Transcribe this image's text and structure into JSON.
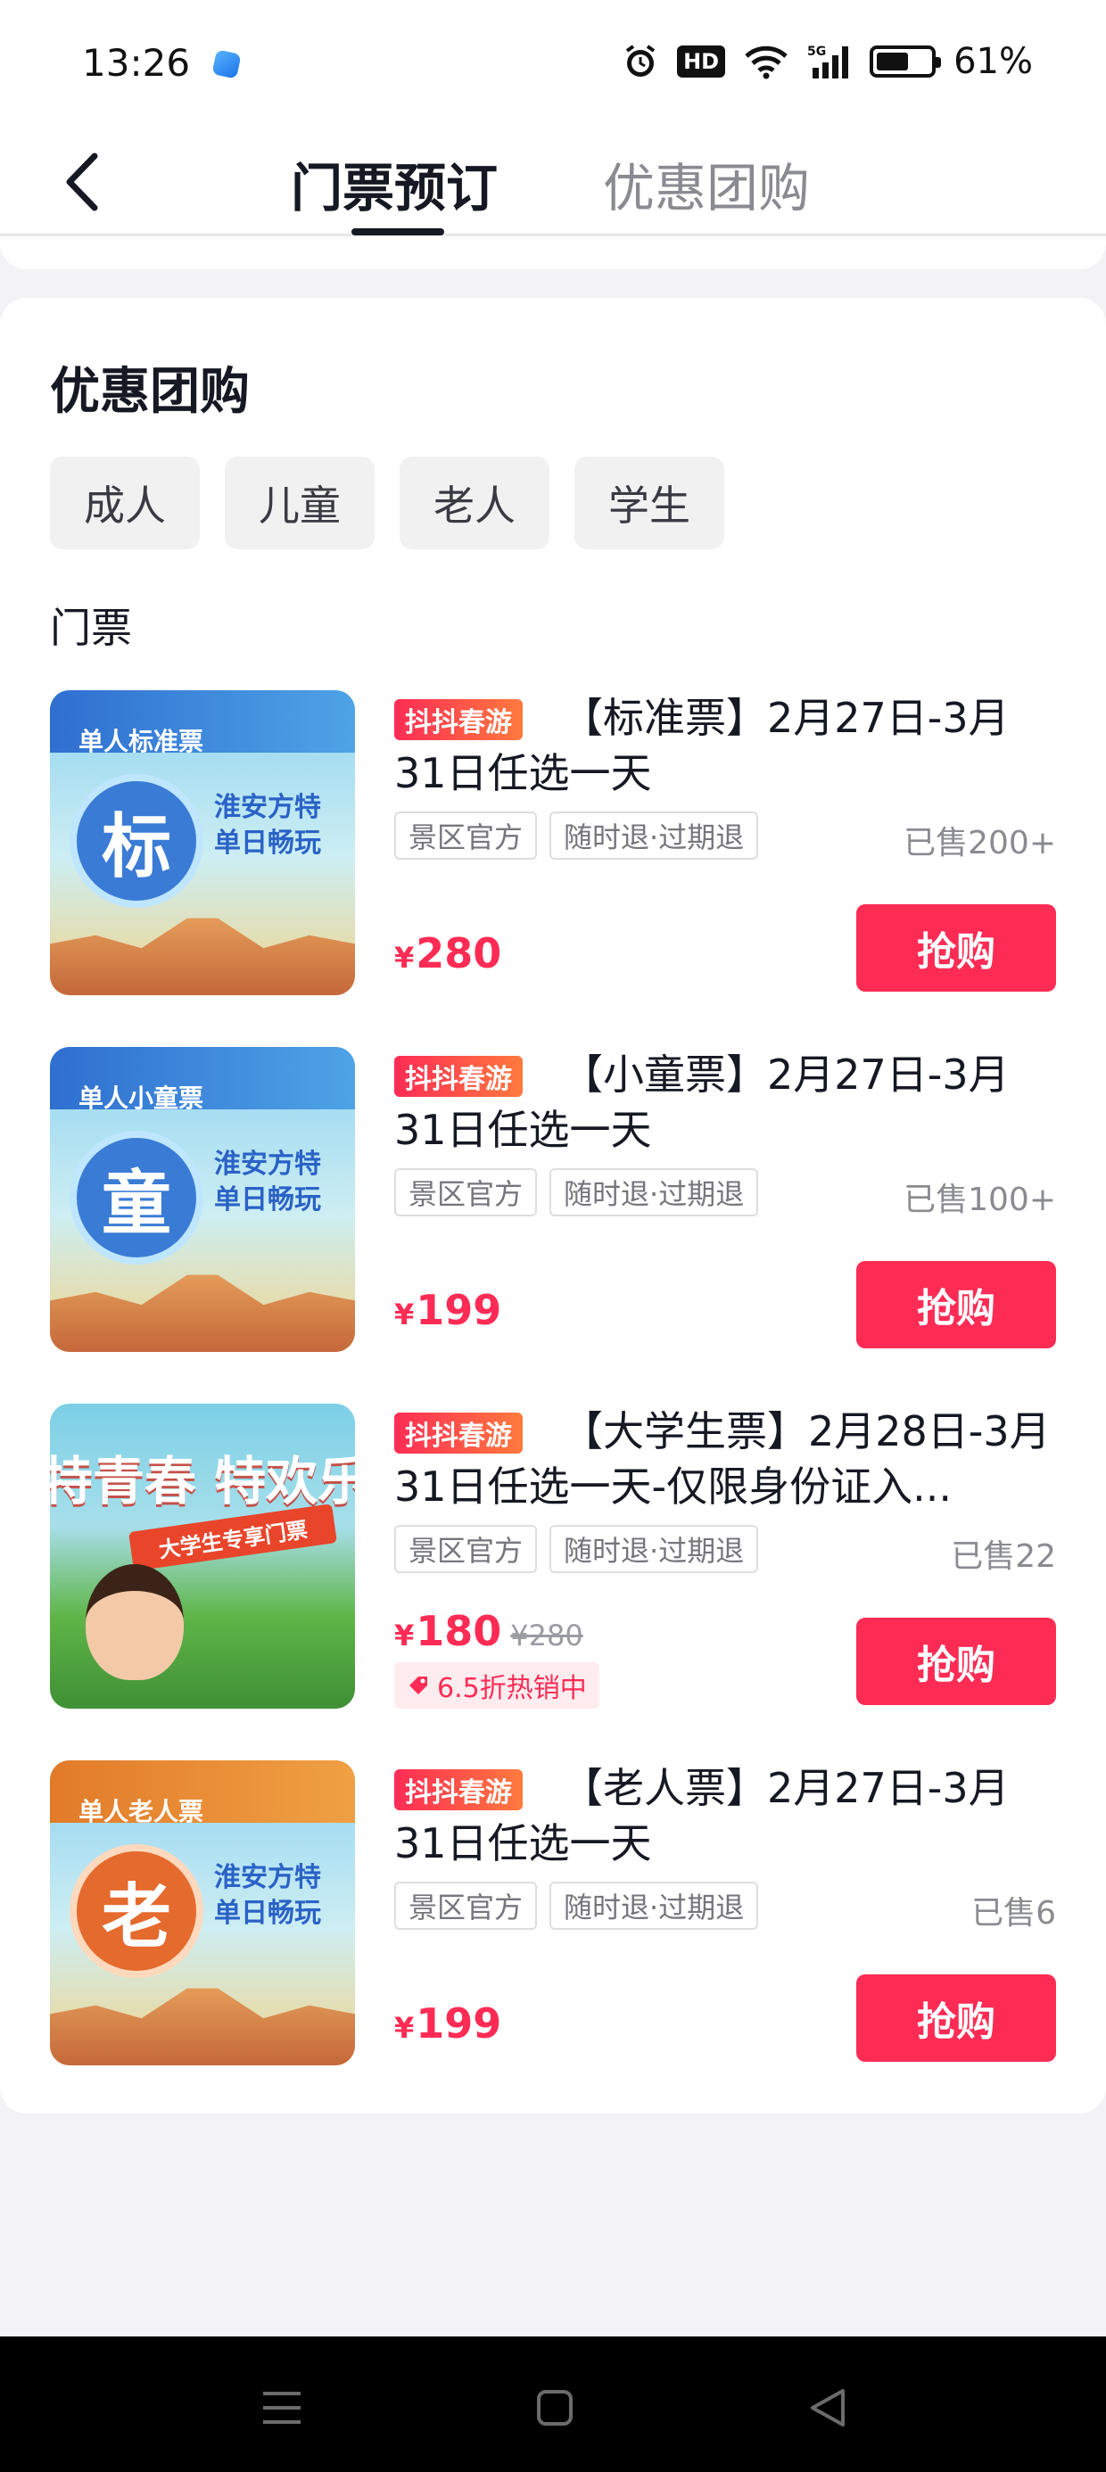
{
  "status_bar": {
    "time": "13:26",
    "battery_percent": "61%",
    "battery_level": 0.61,
    "icons": [
      "alarm-icon",
      "hd-icon",
      "wifi-icon",
      "5g-signal-icon",
      "battery-icon"
    ],
    "hd_label": "HD"
  },
  "nav": {
    "tabs": [
      {
        "label": "门票预订",
        "active": true
      },
      {
        "label": "优惠团购",
        "active": false
      }
    ]
  },
  "section": {
    "title": "优惠团购",
    "filters": [
      "成人",
      "儿童",
      "老人",
      "学生"
    ],
    "subtitle": "门票"
  },
  "items": [
    {
      "badge": "抖抖春游",
      "name": "【标准票】2月27日-3月31日任选一天",
      "tags": [
        "景区官方",
        "随时退·过期退"
      ],
      "sold": "已售200+",
      "price_symbol": "¥",
      "price": "280",
      "buy_label": "抢购",
      "thumb_label": "单人标准票",
      "thumb_char": "标",
      "thumb_side": "淮安方特单日畅玩"
    },
    {
      "badge": "抖抖春游",
      "name": "【小童票】2月27日-3月31日任选一天",
      "tags": [
        "景区官方",
        "随时退·过期退"
      ],
      "sold": "已售100+",
      "price_symbol": "¥",
      "price": "199",
      "buy_label": "抢购",
      "thumb_label": "单人小童票",
      "thumb_char": "童",
      "thumb_side": "淮安方特单日畅玩"
    },
    {
      "badge": "抖抖春游",
      "name": "【大学生票】2月28日-3月31日任选一天-仅限身份证入...",
      "tags": [
        "景区官方",
        "随时退·过期退"
      ],
      "sold": "已售22",
      "price_symbol": "¥",
      "price": "180",
      "original_price": "¥280",
      "discount": "6.5折热销中",
      "buy_label": "抢购",
      "thumb_title": "特青春 特欢乐",
      "thumb_ribbon": "大学生专享门票"
    },
    {
      "badge": "抖抖春游",
      "name": "【老人票】2月27日-3月31日任选一天",
      "tags": [
        "景区官方",
        "随时退·过期退"
      ],
      "sold": "已售6",
      "price_symbol": "¥",
      "price": "199",
      "buy_label": "抢购",
      "thumb_label": "单人老人票",
      "thumb_char": "老",
      "thumb_side": "淮安方特单日畅玩"
    }
  ],
  "colors": {
    "accent": "#fe2c55",
    "text": "#161823",
    "muted": "#8a8b91"
  }
}
